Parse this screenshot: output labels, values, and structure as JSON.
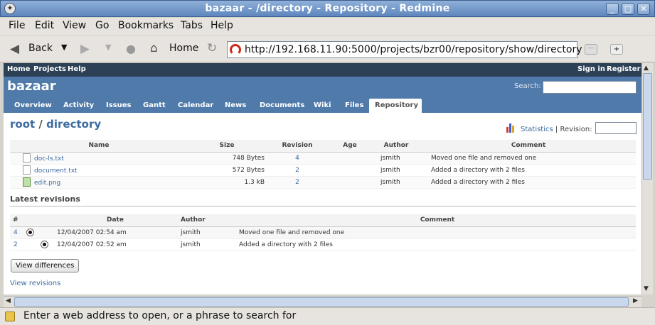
{
  "window": {
    "title": "bazaar - /directory - Repository - Redmine"
  },
  "menu": [
    "File",
    "Edit",
    "View",
    "Go",
    "Bookmarks",
    "Tabs",
    "Help"
  ],
  "nav": {
    "back_label": "Back",
    "home_label": "Home",
    "url": "http://192.168.11.90:5000/projects/bzr00/repository/show/directory"
  },
  "status": {
    "text": "Enter a web address to open, or a phrase to search for"
  },
  "topmenu": {
    "left": [
      "Home",
      "Projects",
      "Help"
    ],
    "right": [
      "Sign in",
      "Register"
    ]
  },
  "header": {
    "project": "bazaar",
    "search_label": "Search:"
  },
  "tabs": [
    "Overview",
    "Activity",
    "Issues",
    "Gantt",
    "Calendar",
    "News",
    "Documents",
    "Wiki",
    "Files",
    "Repository"
  ],
  "selected_tab": "Repository",
  "breadcrumb": {
    "root": "root",
    "sep": " / ",
    "dir": "directory"
  },
  "toolbar": {
    "statistics": "Statistics",
    "revision_label": "| Revision:"
  },
  "files": {
    "headers": [
      "Name",
      "Size",
      "Revision",
      "Age",
      "Author",
      "Comment"
    ],
    "rows": [
      {
        "name": "doc-ls.txt",
        "size": "748 Bytes",
        "revision": "4",
        "age": "",
        "author": "jsmith",
        "comment": "Moved one file and removed one",
        "icon": "text-file-icon"
      },
      {
        "name": "document.txt",
        "size": "572 Bytes",
        "revision": "2",
        "age": "",
        "author": "jsmith",
        "comment": "Added a directory with 2 files",
        "icon": "text-file-icon"
      },
      {
        "name": "edit.png",
        "size": "1.3 kB",
        "revision": "2",
        "age": "",
        "author": "jsmith",
        "comment": "Added a directory with 2 files",
        "icon": "image-file-icon"
      }
    ]
  },
  "latest": {
    "title": "Latest revisions",
    "headers": [
      "#",
      "",
      "",
      "Date",
      "Author",
      "Comment"
    ],
    "rows": [
      {
        "rev": "4",
        "date": "12/04/2007 02:54 am",
        "author": "jsmith",
        "comment": "Moved one file and removed one"
      },
      {
        "rev": "2",
        "date": "12/04/2007 02:52 am",
        "author": "jsmith",
        "comment": "Added a directory with 2 files"
      }
    ],
    "view_differences": "View differences",
    "view_revisions": "View revisions"
  },
  "colors": {
    "header": "#507aaa",
    "topmenu": "#2c4056",
    "link": "#3c6b9e"
  }
}
